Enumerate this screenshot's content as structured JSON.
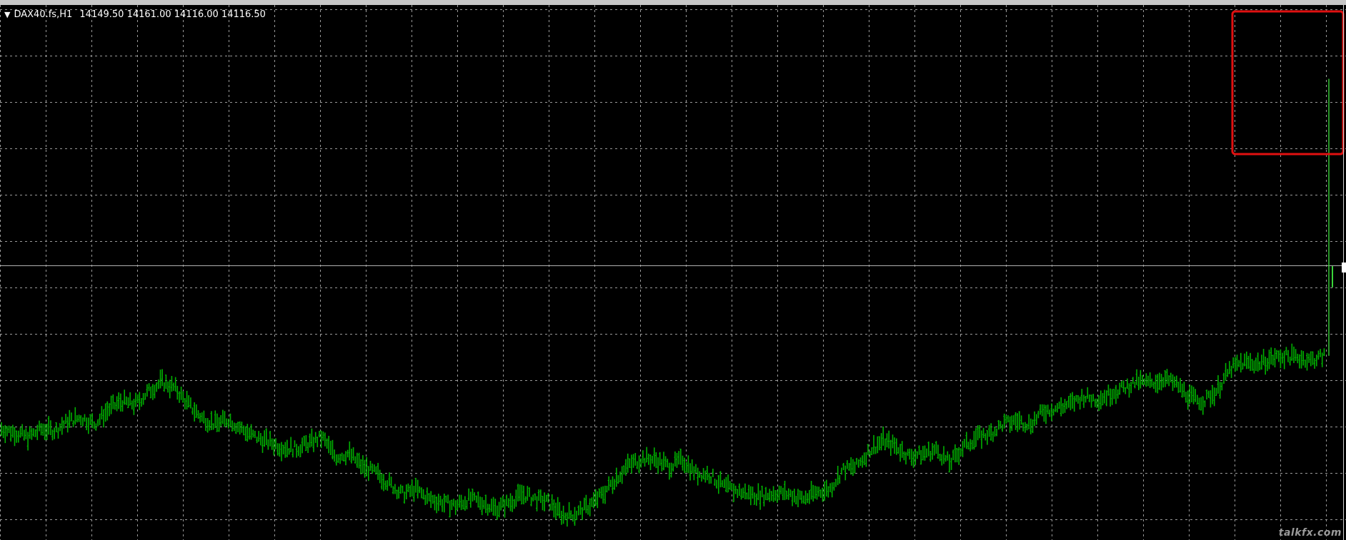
{
  "chart_window": {
    "symbol_label": "DAX40.fs,H1",
    "quote": {
      "open": "14149.50",
      "high": "14161.00",
      "low": "14116.00",
      "close": "14116.50"
    },
    "watermark": "talkfx.com"
  },
  "chart_data": {
    "type": "bar",
    "title": "DAX40.fs,H1",
    "series": [
      {
        "name": "",
        "color": "#00b000",
        "values": [
          0.55,
          0.53,
          0.5,
          0.55,
          0.54,
          0.6,
          0.62,
          0.58,
          0.67,
          0.72,
          0.7,
          0.78,
          0.84,
          0.8,
          0.7,
          0.62,
          0.58,
          0.61,
          0.55,
          0.5,
          0.47,
          0.44,
          0.43,
          0.46,
          0.5,
          0.38,
          0.4,
          0.32,
          0.28,
          0.22,
          0.15,
          0.18,
          0.12,
          0.1,
          0.08,
          0.12,
          0.1,
          0.06,
          0.1,
          0.15,
          0.12,
          0.1,
          0.02,
          0.03,
          0.08,
          0.15,
          0.25,
          0.33,
          0.37,
          0.36,
          0.32,
          0.36,
          0.28,
          0.27,
          0.2,
          0.17,
          0.15,
          0.14,
          0.16,
          0.15,
          0.12,
          0.16,
          0.18,
          0.3,
          0.32,
          0.42,
          0.48,
          0.44,
          0.38,
          0.4,
          0.42,
          0.34,
          0.44,
          0.5,
          0.52,
          0.58,
          0.6,
          0.58,
          0.66,
          0.68,
          0.7,
          0.75,
          0.73,
          0.77,
          0.8,
          0.84,
          0.83,
          0.86,
          0.82,
          0.74,
          0.72,
          0.79,
          0.92,
          0.96,
          0.95,
          0.98,
          1.0,
          0.99,
          0.97,
          1.0
        ]
      }
    ],
    "last_bar_spike_high": 2.7,
    "last_bar_close": 1.5,
    "ylim": [
      0,
      3
    ],
    "grid": true
  }
}
